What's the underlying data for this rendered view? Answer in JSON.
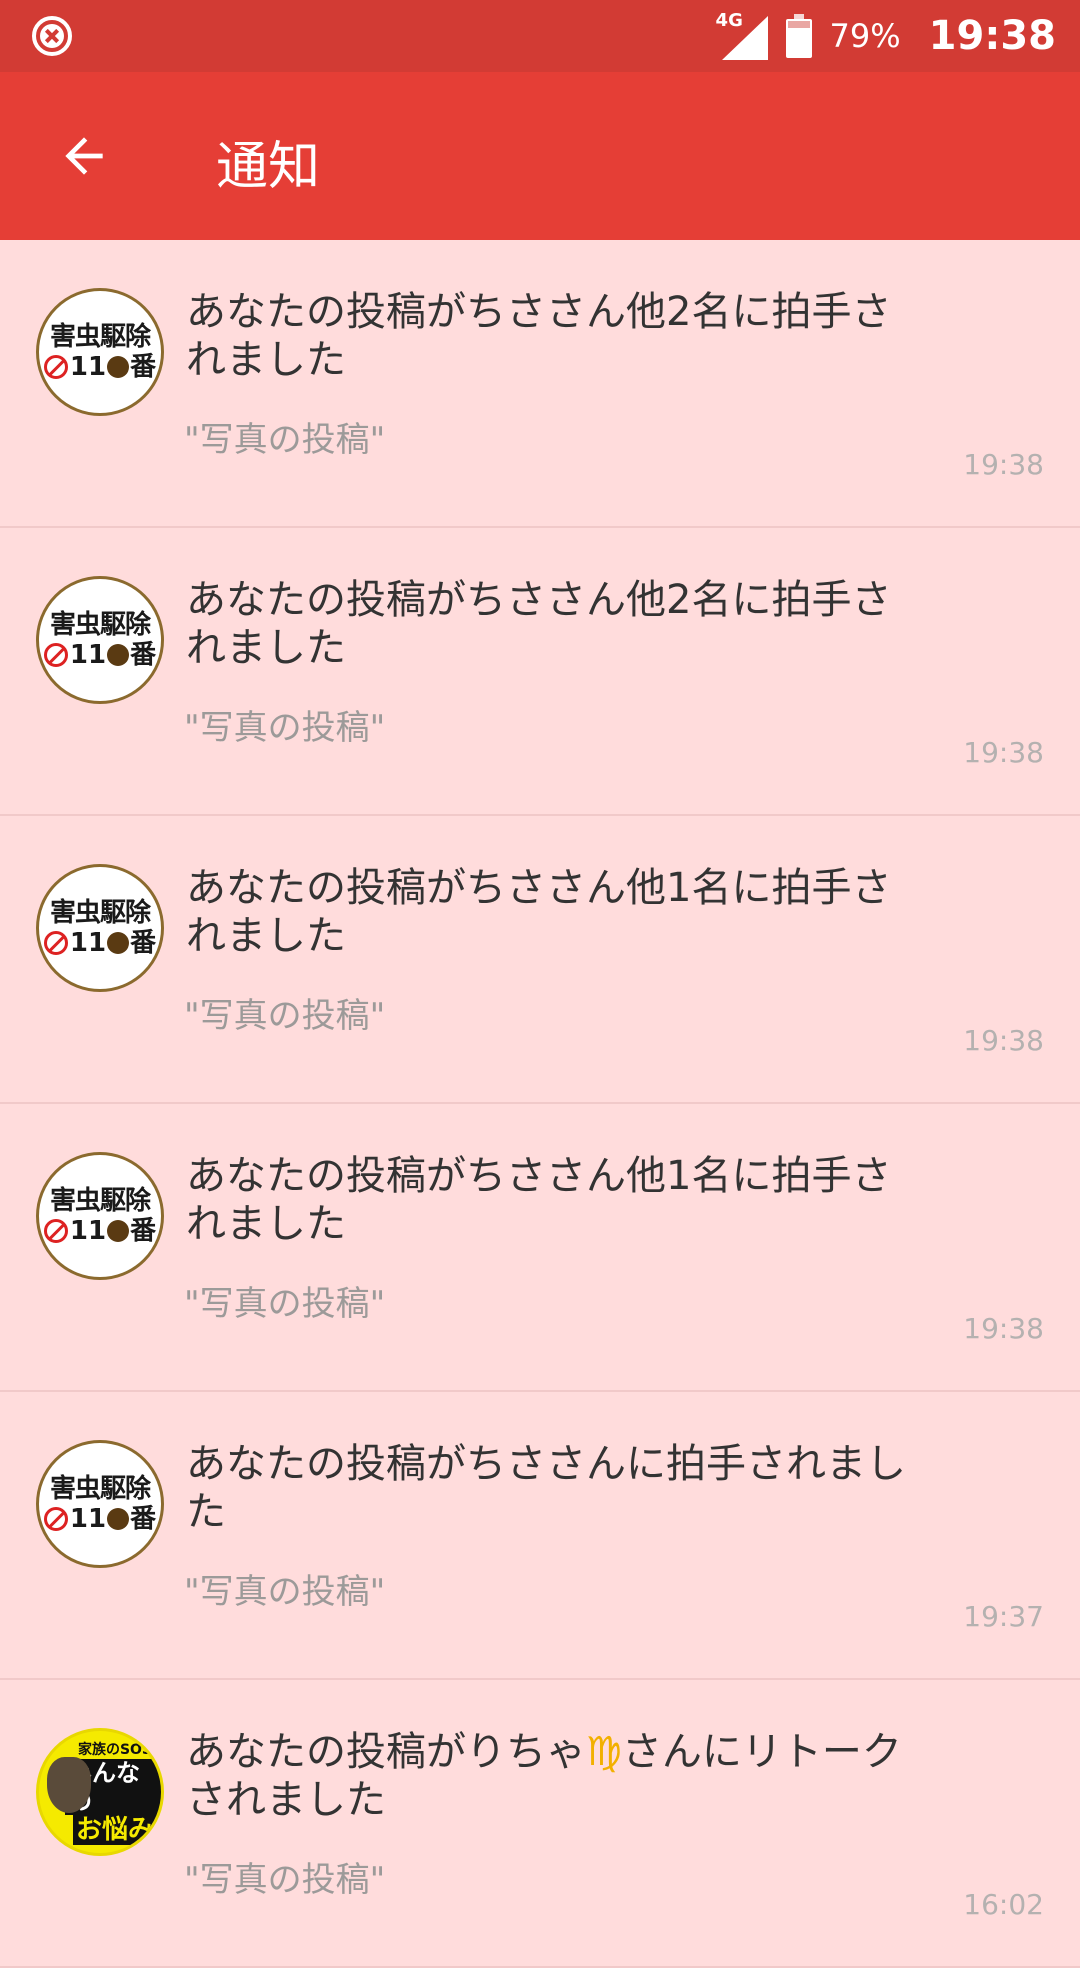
{
  "status_bar": {
    "network": "4G",
    "battery_percent": "79%",
    "battery_level": 0.79,
    "time": "19:38",
    "left_icon": "close-circle-icon"
  },
  "app_bar": {
    "title": "通知",
    "back_icon": "arrow-left-icon"
  },
  "avatar_logo": {
    "line1": "害虫駆除",
    "line2_a": "11",
    "line2_b": "番"
  },
  "avatar_logo2": {
    "line1": "家族のSOS",
    "line2": "みんなの",
    "line3": "お悩み"
  },
  "notifications": [
    {
      "message": "あなたの投稿がちささん他2名に拍手されました",
      "subtitle": "\"写真の投稿\"",
      "time": "19:38",
      "avatar": "pest-logo"
    },
    {
      "message": "あなたの投稿がちささん他2名に拍手されました",
      "subtitle": "\"写真の投稿\"",
      "time": "19:38",
      "avatar": "pest-logo"
    },
    {
      "message": "あなたの投稿がちささん他1名に拍手されました",
      "subtitle": "\"写真の投稿\"",
      "time": "19:38",
      "avatar": "pest-logo"
    },
    {
      "message": "あなたの投稿がちささん他1名に拍手されました",
      "subtitle": "\"写真の投稿\"",
      "time": "19:38",
      "avatar": "pest-logo"
    },
    {
      "message": "あなたの投稿がちささんに拍手されました",
      "subtitle": "\"写真の投稿\"",
      "time": "19:37",
      "avatar": "pest-logo"
    },
    {
      "message_a": "あなたの投稿がりちゃ",
      "message_emoji": "♍",
      "message_b": "さんにリトークされました",
      "subtitle": "\"写真の投稿\"",
      "time": "16:02",
      "avatar": "family-sos-logo"
    }
  ]
}
